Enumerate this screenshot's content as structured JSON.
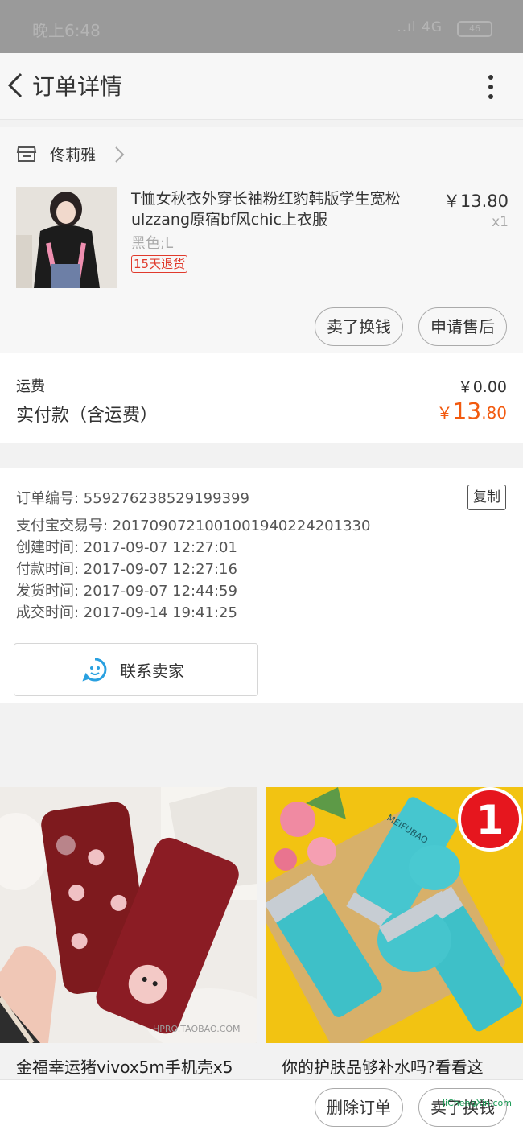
{
  "status_bar": {
    "time": "晚上6:48",
    "signal": "..ıl 4G",
    "battery": "46"
  },
  "header": {
    "title": "订单详情"
  },
  "shop": {
    "name": "佟莉雅"
  },
  "product": {
    "title": "T恤女秋衣外穿长袖粉红豹韩版学生宽松ulzzang原宿bf风chic上衣服",
    "variant": "黑色;L",
    "tag": "15天退货",
    "price": "￥13.80",
    "qty": "x1",
    "sell_button": "卖了换钱",
    "aftersale_button": "申请售后"
  },
  "totals": {
    "shipping_label": "运费",
    "shipping_value": "￥0.00",
    "paid_label": "实付款（含运费）",
    "paid_currency": "￥",
    "paid_int": "13",
    "paid_dec": ".80"
  },
  "order": {
    "lines": [
      "订单编号: 559276238529199399",
      "支付宝交易号: 2017090721001001940224201330",
      "创建时间: 2017-09-07 12:27:01",
      "付款时间: 2017-09-07 12:27:16",
      "发货时间: 2017-09-07 12:44:59",
      "成交时间: 2017-09-14 19:41:25"
    ],
    "copy_button": "复制",
    "contact_button": "联系卖家"
  },
  "recommendations": [
    {
      "title": "金福幸运猪vivox5m手机壳x5",
      "watermark": "HPRO.TAOBAO.COM"
    },
    {
      "title": "你的护肤品够补水吗?看看这",
      "badge": "1",
      "brand": "MEIFUBAO"
    }
  ],
  "bottom_bar": {
    "delete_button": "删除订单",
    "sell_button": "卖了换钱"
  },
  "watermark": "JiChengXin.com",
  "colors": {
    "accent_price": "#f25a0f",
    "tag_red": "#e03a2c",
    "contact_icon": "#29a0e0"
  }
}
